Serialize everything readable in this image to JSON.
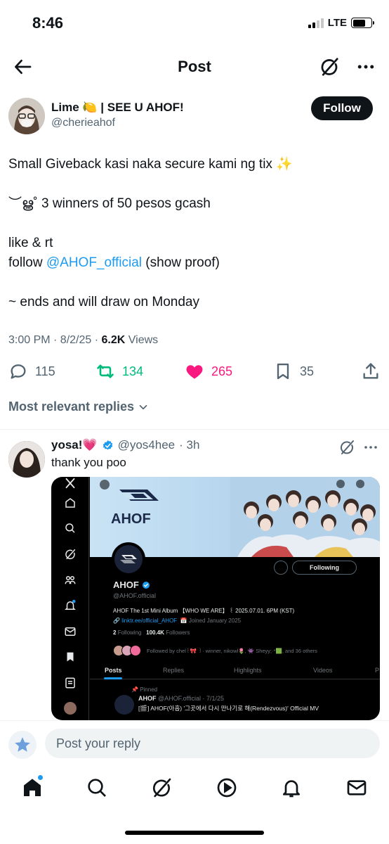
{
  "status_bar": {
    "time": "8:46",
    "network": "LTE"
  },
  "header": {
    "title": "Post"
  },
  "author": {
    "name": "Lime 🍋 | SEE U AHOF!",
    "handle": "@cherieahof",
    "follow_label": "Follow"
  },
  "post": {
    "line1": "Small Giveback kasi naka secure kami ng tix ✨",
    "line2": "︶ൠ˚ 3 winners of 50 pesos gcash",
    "line3": "like & rt",
    "line4_prefix": "follow ",
    "line4_mention": "@AHOF_official",
    "line4_suffix": " (show proof)",
    "line5": "~ ends and will draw on Monday",
    "time": "3:00 PM · 8/2/25 · ",
    "views_count": "6.2K",
    "views_label": " Views"
  },
  "actions": {
    "replies": "115",
    "reposts": "134",
    "likes": "265",
    "bookmarks": "35"
  },
  "colors": {
    "repost": "#00ba7c",
    "like": "#f91880",
    "mention": "#1d9bf0"
  },
  "replies_sort": "Most relevant replies",
  "reply": {
    "name": "yosa!💗",
    "handle": "@yos4hee",
    "time": "· 3h",
    "text": "thank you poo"
  },
  "embed": {
    "banner_logo": "AHOF",
    "name": "AHOF",
    "handle": "@AHOF.official",
    "bio": "AHOF The 1st Mini Album 【WHO WE ARE】 ꒰ 2025.07.01. 6PM (KST)",
    "link": "linktr.ee/official_AHOF",
    "joined": "Joined January 2025",
    "following_count": "2",
    "following_label": "Following",
    "followers_count": "100.4K",
    "followers_label": "Followers",
    "followed_by": "Followed by chel꒰🎀 ꒱· winner, nikowl🌷, 👾 Sheyy;·*🟩, and 36 others",
    "following_btn": "Following",
    "tabs": [
      "Posts",
      "Replies",
      "Highlights",
      "Videos",
      "P"
    ],
    "pinned": "Pinned",
    "post_name": "AHOF",
    "post_handle": "@AHOF.official · 7/1/25",
    "post_text": "[🎬] AHOF(아홉) '그곳에서 다시 만나기로 해(Rendezvous)' Official MV"
  },
  "reply_bar": {
    "placeholder": "Post your reply"
  },
  "icons": [
    "back-icon",
    "grok-icon",
    "more-icon",
    "reply-icon",
    "repost-icon",
    "like-icon",
    "bookmark-icon",
    "share-icon",
    "home-icon",
    "search-icon",
    "grok-icon",
    "video-icon",
    "notifications-icon",
    "messages-icon"
  ]
}
